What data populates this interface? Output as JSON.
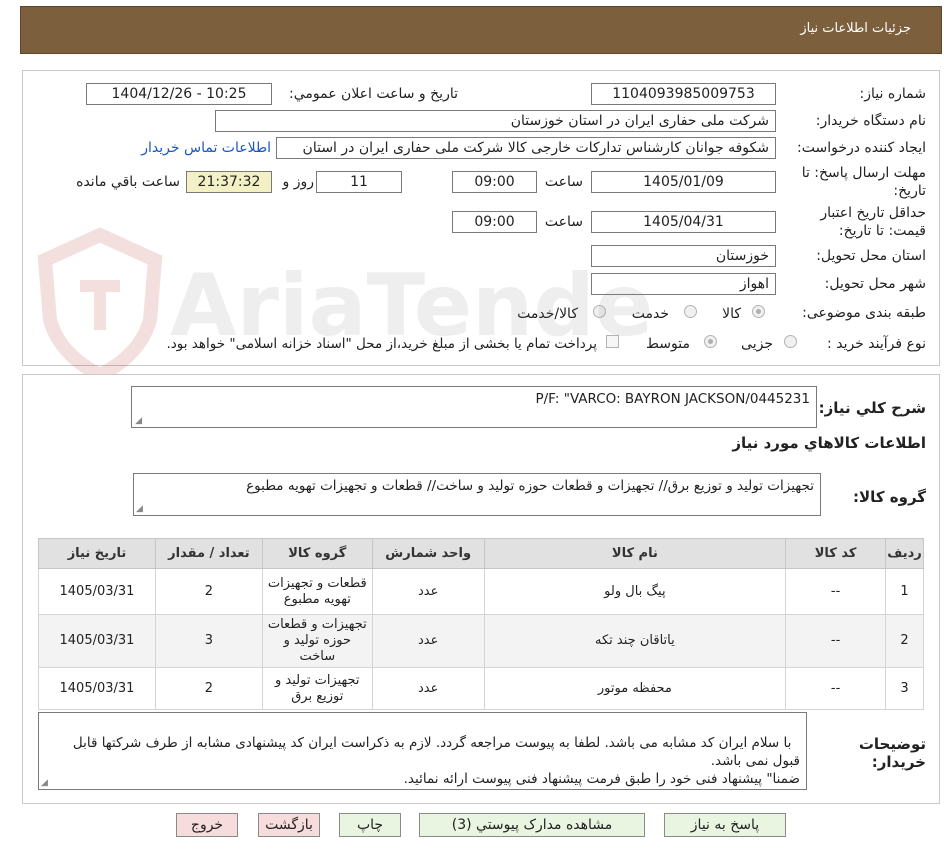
{
  "header": {
    "title": "جزئیات اطلاعات نیاز"
  },
  "form": {
    "need_number": {
      "label": "شماره نیاز:",
      "value": "1104093985009753"
    },
    "announce_datetime": {
      "label": "تاریخ و ساعت اعلان عمومي:",
      "value": "1404/12/26 - 10:25"
    },
    "buyer_org": {
      "label": "نام دستگاه خريدار:",
      "value": "شرکت ملی حفاری ایران در استان خوزستان"
    },
    "requester": {
      "label": "ايجاد كننده درخواست:",
      "value": "شکوفه جوانان کارشناس تدارکات خارجی کالا شرکت ملی حفاری ایران در استان",
      "contact_link": "اطلاعات تماس خريدار"
    },
    "reply_deadline": {
      "label_line1": "مهلت ارسال پاسخ: تا",
      "label_line2": "تاریخ:",
      "date": "1405/01/09",
      "time_label": "ساعت",
      "time": "09:00",
      "days": "11",
      "days_label": "روز و",
      "remaining": "21:37:32",
      "remaining_label": "ساعت باقي مانده"
    },
    "price_validity": {
      "label_line1": "حداقل تاريخ اعتبار",
      "label_line2": "قيمت: تا تاريخ:",
      "date": "1405/04/31",
      "time_label": "ساعت",
      "time": "09:00"
    },
    "delivery_province": {
      "label": "استان محل تحويل:",
      "value": "خوزستان"
    },
    "delivery_city": {
      "label": "شهر محل تحويل:",
      "value": "اهواز"
    },
    "category": {
      "label": "طبقه بندی موضوعی:",
      "options": [
        "کالا",
        "خدمت",
        "کالا/خدمت"
      ],
      "selected": "کالا"
    },
    "purchase_process": {
      "label": "نوع فرآیند خرید :",
      "options": [
        "جزیی",
        "متوسط"
      ],
      "selected": "متوسط",
      "payment_note": "پرداخت تمام یا بخشی از مبلغ خرید،از محل \"اسناد خزانه اسلامی\" خواهد بود."
    }
  },
  "summary": {
    "label": "شرح كلي نياز:",
    "value": "P/F: \"VARCO: BAYRON JACKSON/0445231"
  },
  "goods_info_title": "اطلاعات کالاهاي مورد نياز",
  "goods_group": {
    "label": "گروه کالا:",
    "value": "تجهیزات تولید و توزیع برق// تجهیزات و قطعات حوزه تولید و ساخت//  قطعات و تجهیزات تهویه مطبوع"
  },
  "table": {
    "headers": [
      "رديف",
      "کد کالا",
      "نام کالا",
      "واحد شمارش",
      "گروه کالا",
      "تعداد / مقدار",
      "تاریخ نیاز"
    ],
    "rows": [
      {
        "row": "1",
        "code": "--",
        "name": "پیگ بال ولو",
        "unit": "عدد",
        "group": "قطعات و تجهیزات تهویه مطبوع",
        "qty": "2",
        "date": "1405/03/31"
      },
      {
        "row": "2",
        "code": "--",
        "name": "یاتاقان چند تکه",
        "unit": "عدد",
        "group": "تجهیزات و قطعات حوزه تولید و ساخت",
        "qty": "3",
        "date": "1405/03/31"
      },
      {
        "row": "3",
        "code": "--",
        "name": "محفظه موتور",
        "unit": "عدد",
        "group": "تجهیزات تولید و توزیع برق",
        "qty": "2",
        "date": "1405/03/31"
      }
    ]
  },
  "buyer_notes": {
    "label_line1": "توضیحات",
    "label_line2": "خریدار:",
    "value": "با سلام ایران کد مشابه می باشد. لطفا به پیوست مراجعه گردد. لازم به ذکراست ایران کد پیشنهادی مشابه از طرف شرکتها قابل قبول نمی باشد.\nضمنا\" پیشنهاد فنی خود را طبق فرمت پیشنهاد فنی پیوست ارائه نمائید."
  },
  "buttons": {
    "reply": "پاسخ به نیاز",
    "attachments": "مشاهده مدارک پیوستي (3)",
    "print": "چاپ",
    "back": "بازگشت",
    "exit": "خروج"
  },
  "watermark": {
    "text": "AriaTender.neT"
  }
}
